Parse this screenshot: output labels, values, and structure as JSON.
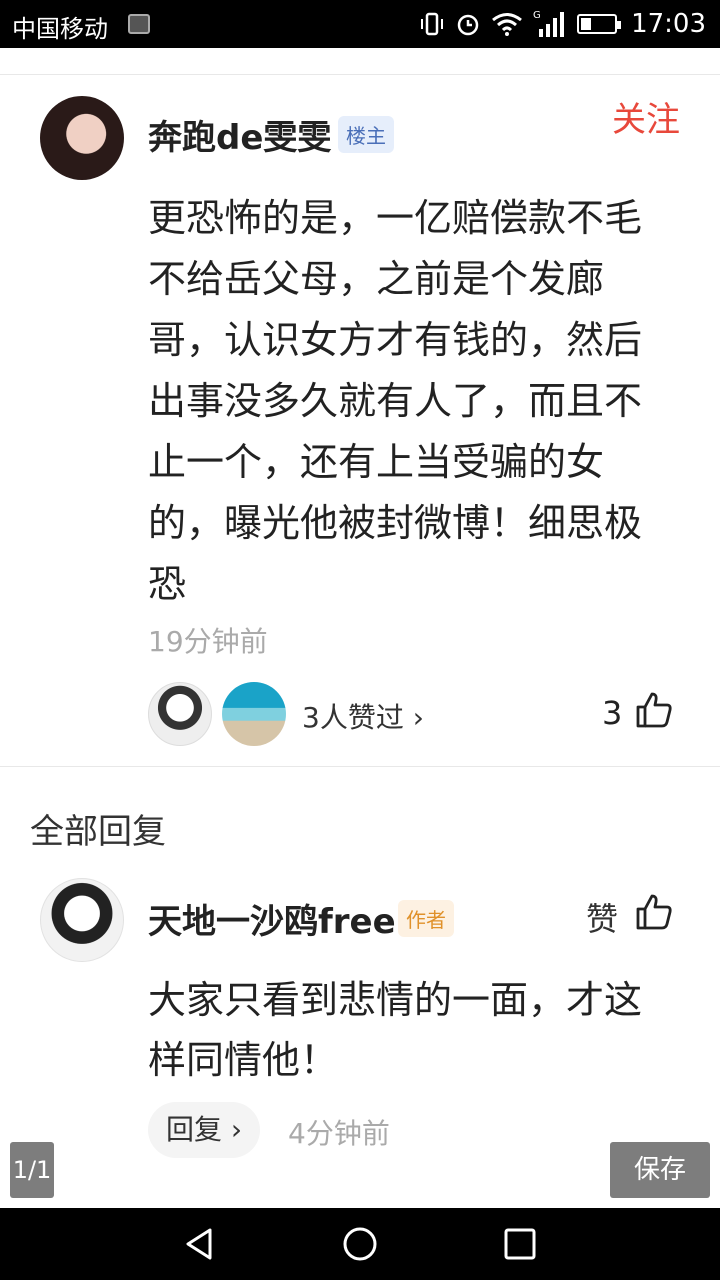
{
  "status_bar": {
    "carrier": "中国移动",
    "time": "17:03",
    "signal_label": "G",
    "icons": [
      "notification-image-icon",
      "vibrate-icon",
      "alarm-icon",
      "wifi-icon",
      "signal-icon",
      "battery-icon"
    ],
    "battery_level": 0.3
  },
  "main_comment": {
    "author": "奔跑de雯雯",
    "badge": "楼主",
    "follow_label": "关注",
    "text": "更恐怖的是，一亿赔偿款不毛不给岳父母，之前是个发廊哥，认识女方才有钱的，然后出事没多久就有人了，而且不止一个，还有上当受骗的女的，曝光他被封微博！细思极恐",
    "time": "19分钟前",
    "likers_text": "3人赞过 ›",
    "like_count": "3"
  },
  "replies": {
    "title": "全部回复",
    "items": [
      {
        "author": "天地一沙鸥free",
        "badge": "作者",
        "like_label": "赞",
        "text": "大家只看到悲情的一面，才这样同情他！",
        "reply_label": "回复 ›",
        "time": "4分钟前"
      }
    ]
  },
  "viewer": {
    "page_indicator": "1/1",
    "save_label": "保存"
  },
  "colors": {
    "accent_red": "#e8483b",
    "owner_badge": "#4a6fb8",
    "author_badge": "#e0912a"
  }
}
